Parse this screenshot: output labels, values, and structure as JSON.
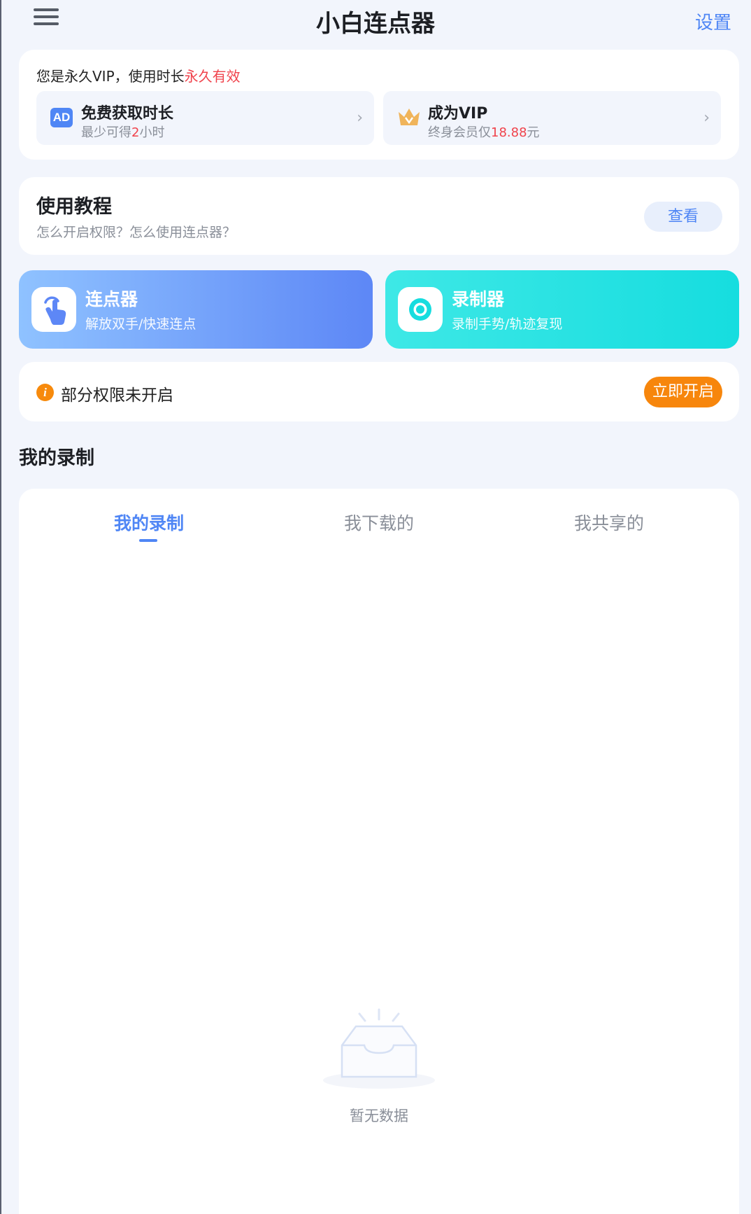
{
  "header": {
    "title": "小白连点器",
    "settings_label": "设置",
    "menu_icon": "hamburger-icon"
  },
  "vip": {
    "status_prefix": "您是永久VIP，使用时长",
    "status_value": "永久有效",
    "free_time": {
      "title": "免费获取时长",
      "sub_prefix": "最少可得",
      "sub_value": "2",
      "sub_suffix": "小时",
      "icon": "AD"
    },
    "become_vip": {
      "title": "成为VIP",
      "sub_prefix": "终身会员仅",
      "sub_value": "18.88",
      "sub_suffix": "元"
    }
  },
  "tutorial": {
    "title": "使用教程",
    "subtitle": "怎么开启权限？怎么使用连点器？",
    "button": "查看"
  },
  "features": {
    "clicker": {
      "title": "连点器",
      "subtitle": "解放双手/快速连点"
    },
    "recorder": {
      "title": "录制器",
      "subtitle": "录制手势/轨迹复现"
    }
  },
  "permission": {
    "text": "部分权限未开启",
    "button": "立即开启",
    "icon": "i"
  },
  "records": {
    "section_title": "我的录制",
    "tabs": [
      "我的录制",
      "我下载的",
      "我共享的"
    ],
    "active_tab": 0,
    "empty_text": "暂无数据"
  },
  "colors": {
    "accent": "#4f86f5",
    "orange": "#f7860c",
    "red": "#f0434c",
    "background": "#f2f5fc"
  }
}
